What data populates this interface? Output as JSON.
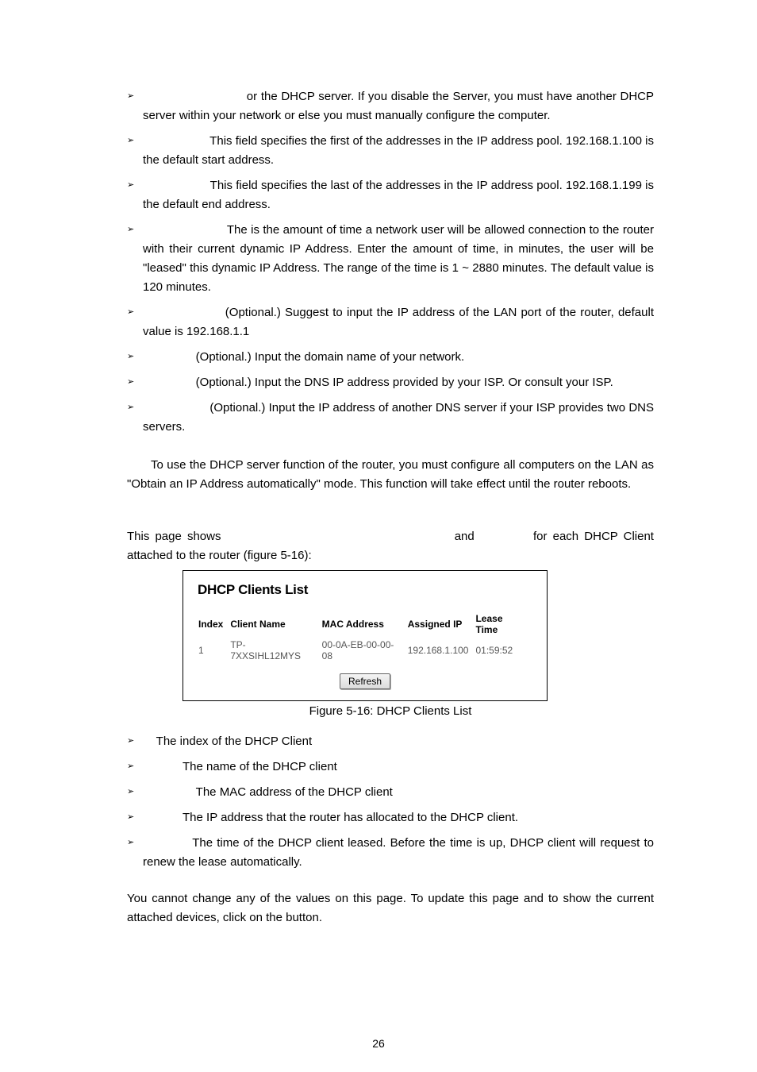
{
  "bullets1": [
    "or            the DHCP server. If you disable the Server, you must have another DHCP server within your network or else you must manually configure the computer.",
    "This field specifies the first of the addresses in the IP address pool. 192.168.1.100 is the default start address.",
    "This field specifies the last of the addresses in the IP address pool. 192.168.1.199 is the default end address.",
    "The                           is the amount of time a network user will be allowed connection to the router with their current dynamic IP Address. Enter the amount of time, in minutes, the user will be \"leased\" this dynamic IP Address. The range of the time is 1 ~ 2880 minutes. The default value is 120 minutes.",
    "(Optional.) Suggest to input the IP address of the LAN port of the router, default value is 192.168.1.1",
    "(Optional.) Input the domain name of your network.",
    "(Optional.) Input the DNS IP address provided by your ISP. Or consult your ISP.",
    "(Optional.) Input the IP address of another DNS server if your ISP provides two DNS servers."
  ],
  "bullet1_indents": [
    7,
    5,
    5,
    6,
    5,
    4,
    4,
    5
  ],
  "para_note": "To use the DHCP server function of the router, you must configure all computers on the LAN as \"Obtain an IP Address automatically\" mode. This function will take effect until the router reboots.",
  "intro_a": "This page shows ",
  "intro_b": " and ",
  "intro_c": " for each DHCP Client attached to the router (figure 5-16):",
  "figure": {
    "title": "DHCP Clients List",
    "headers": [
      "Index",
      "Client Name",
      "MAC Address",
      "Assigned IP",
      "Lease Time"
    ],
    "row": [
      "1",
      "TP-7XXSIHL12MYS",
      "00-0A-EB-00-00-08",
      "192.168.1.100",
      "01:59:52"
    ],
    "button": "Refresh",
    "caption": "Figure 5-16: DHCP Clients List"
  },
  "bullets2": [
    "The index of the DHCP Client",
    "The name of the DHCP client",
    "The MAC address of the DHCP client",
    "The IP address that the router has allocated to the DHCP client.",
    "The time of the DHCP client leased. Before the time is up, DHCP client will request to renew the lease automatically."
  ],
  "bullet2_indents": [
    1,
    3,
    4,
    3,
    3
  ],
  "closing": "You cannot change any of the values on this page. To update this page and to show the current attached devices, click on the              button.",
  "page_number": "26"
}
